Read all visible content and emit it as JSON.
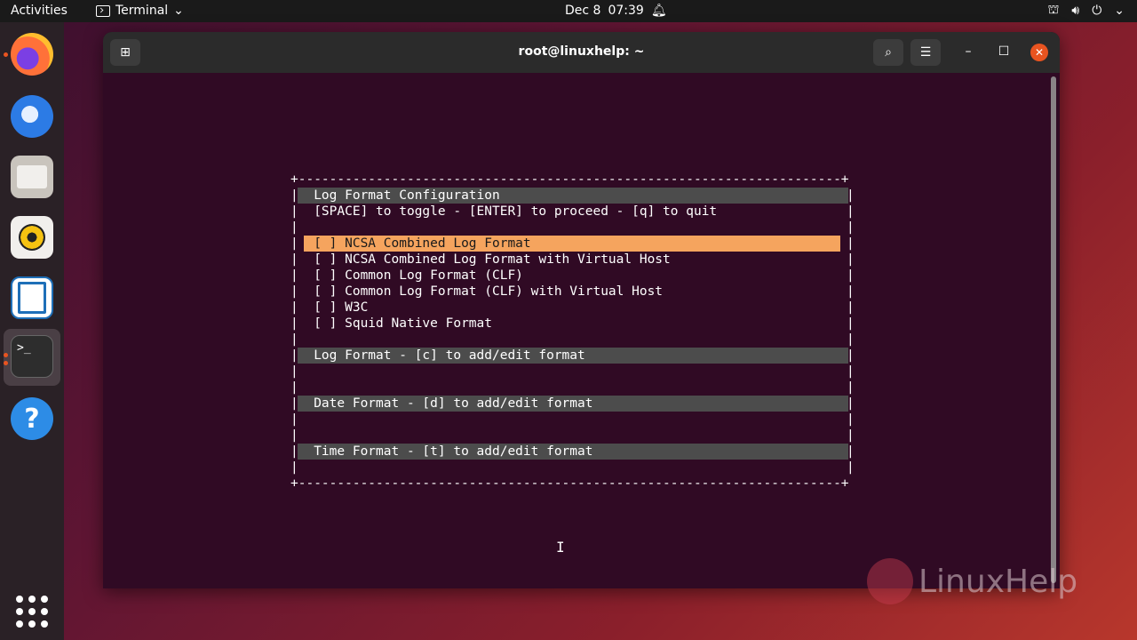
{
  "topbar": {
    "activities": "Activities",
    "app_name": "Terminal",
    "date": "Dec 8",
    "time": "07:39"
  },
  "window": {
    "title": "root@linuxhelp: ~"
  },
  "terminal": {
    "border_top": "+----------------------------------------------------------------------+",
    "title": "Log Format Configuration",
    "instructions": "[SPACE] to toggle - [ENTER] to proceed - [q] to quit",
    "options": [
      "[ ] NCSA Combined Log Format",
      "[ ] NCSA Combined Log Format with Virtual Host",
      "[ ] Common Log Format (CLF)",
      "[ ] Common Log Format (CLF) with Virtual Host",
      "[ ] W3C",
      "[ ] Squid Native Format"
    ],
    "log_format": "Log Format - [c] to add/edit format",
    "date_format": "Date Format - [d] to add/edit format",
    "time_format": "Time Format - [t] to add/edit format",
    "border_bottom": "+----------------------------------------------------------------------+"
  },
  "watermark": "LinuxHelp",
  "colors": {
    "terminal_bg": "#300a24",
    "highlight": "#f5a45e",
    "bar": "#4c4c4c",
    "accent": "#e95420"
  }
}
